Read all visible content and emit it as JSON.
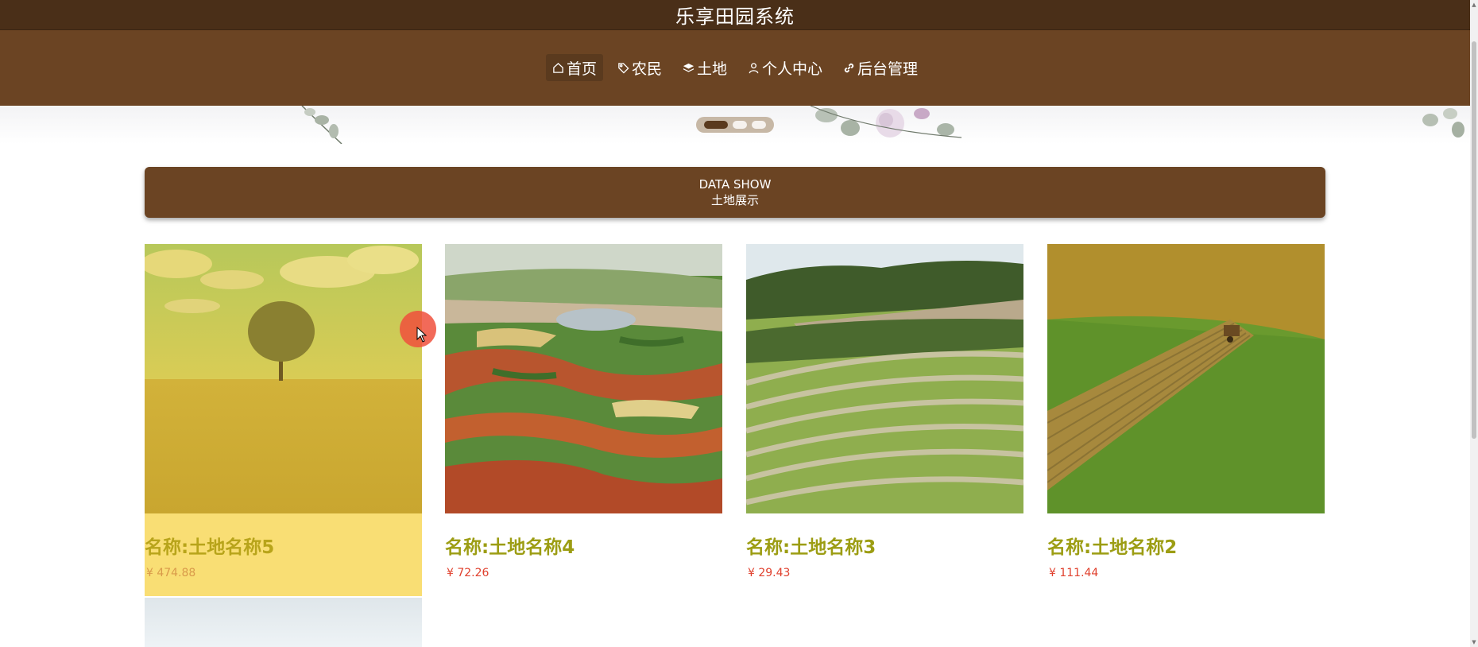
{
  "app": {
    "title": "乐享田园系统"
  },
  "nav": {
    "items": [
      {
        "label": "首页",
        "icon": "home-icon",
        "active": true
      },
      {
        "label": "农民",
        "icon": "tag-icon",
        "active": false
      },
      {
        "label": "土地",
        "icon": "layers-icon",
        "active": false
      },
      {
        "label": "个人中心",
        "icon": "user-icon",
        "active": false
      },
      {
        "label": "后台管理",
        "icon": "link-icon",
        "active": false
      }
    ]
  },
  "carousel": {
    "slides": 3,
    "active_index": 0
  },
  "section": {
    "subtitle_en": "DATA SHOW",
    "title": "土地展示"
  },
  "cards": [
    {
      "name": "名称:土地名称5",
      "price": "¥ 474.88",
      "image": "field-with-tree"
    },
    {
      "name": "名称:土地名称4",
      "price": "¥ 72.26",
      "image": "terraced-farmland"
    },
    {
      "name": "名称:土地名称3",
      "price": "¥ 29.43",
      "image": "striped-field"
    },
    {
      "name": "名称:土地名称2",
      "price": "¥ 111.44",
      "image": "tractor-field"
    }
  ],
  "colors": {
    "brand_brown": "#6b4423",
    "dark_brown": "#4a2f18",
    "name_olive": "#9c9d13",
    "price_red": "#e0402d",
    "highlight_yellow": "#f9de74"
  }
}
